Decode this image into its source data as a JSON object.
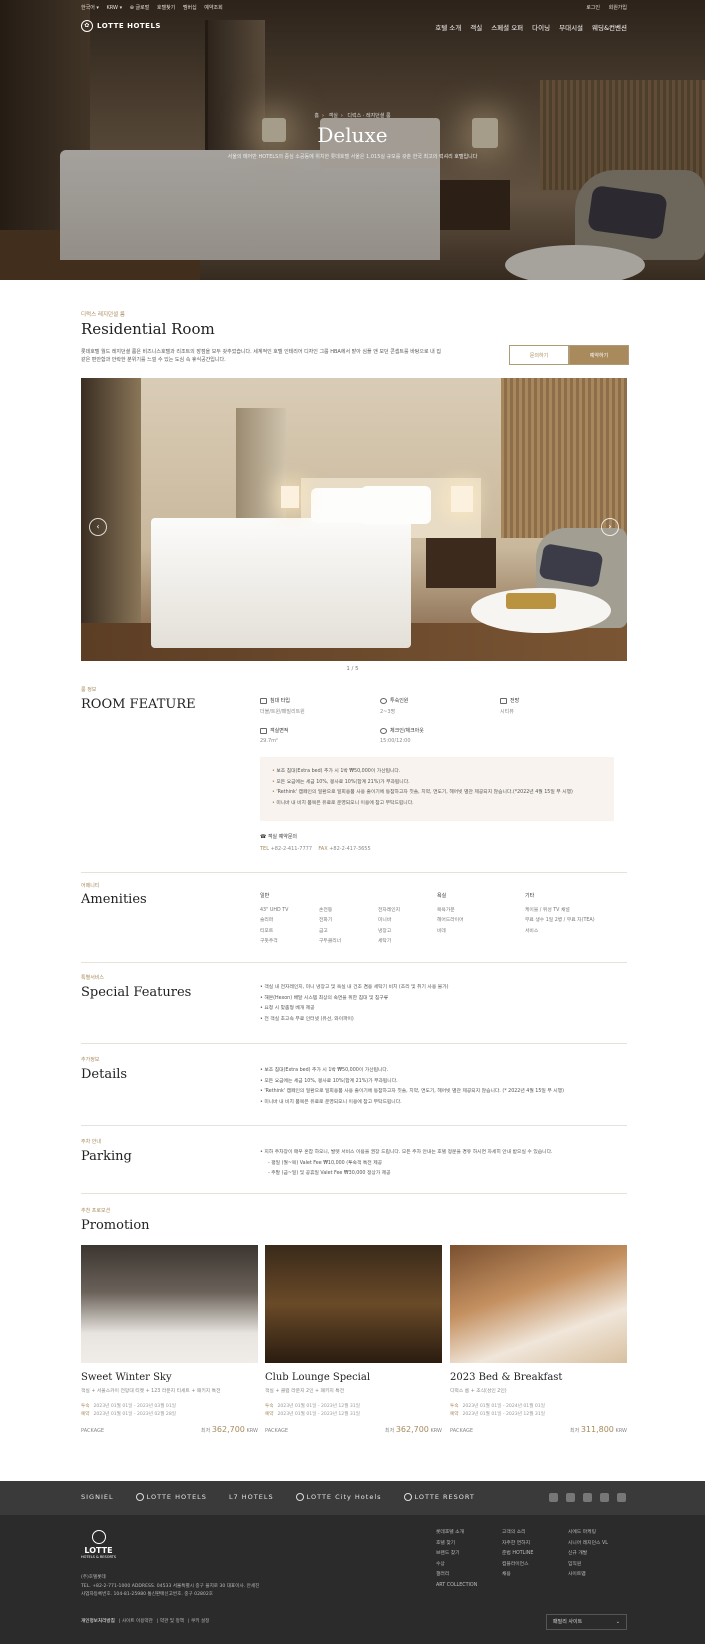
{
  "topbar": {
    "lang": "한국어 ▾",
    "currency": "KRW ▾",
    "links": [
      "⊕ 글로벌",
      "호텔찾기",
      "멤버십",
      "예약조회"
    ],
    "login": "로그인",
    "signup": "회원가입"
  },
  "nav": {
    "logo": "LOTTE HOTELS",
    "items": [
      "호텔 소개",
      "객실",
      "스페셜 오퍼",
      "다이닝",
      "부대시설",
      "웨딩&컨벤션"
    ]
  },
  "hero": {
    "breadcrumb": [
      "홈",
      "객실",
      "디럭스 · 레지던셜 룸"
    ],
    "title": "Deluxe",
    "desc": "서울의 메어반 HOTELS의 중심 소공동에 위치한 롯데호텔 서울은 1,015실 규모를 갖춘 한국 최고의 럭셔리 호텔입니다"
  },
  "room": {
    "category": "디럭스 레지던셜 룸",
    "title": "Residential Room",
    "desc": "롯데호텔 월드 레지던셜 룸은 비즈니스호텔과 리조트의 장점을 모두 갖추었습니다. 세계적인 호텔 인테리어 디자인 그룹 HBA에서 맡아 심플 앤 모던 콘셉트를 바탕으로 내 집 같은 편안함과 안락한 분위기를 느낄 수 있는 도심 속 휴식공간입니다.",
    "inquire_btn": "문의하기",
    "book_btn": "예약하기",
    "pager": "1 / 5"
  },
  "feature": {
    "eyebrow": "룸 정보",
    "title": "ROOM FEATURE",
    "items": [
      {
        "label": "침대 타입",
        "value": "더블/트윈/패밀리트윈"
      },
      {
        "label": "투숙인원",
        "value": "2~3명"
      },
      {
        "label": "전망",
        "value": "시티뷰"
      },
      {
        "label": "객실면적",
        "value": "29.7m²"
      },
      {
        "label": "체크인/체크아웃",
        "value": "15:00/12:00"
      }
    ],
    "notices": [
      "보조 침대(Extra bed) 추가 시 1박 ₩50,000이 가산됩니다.",
      "모든 요금에는 세금 10%, 봉사료 10%(합계 21%)가 부과됩니다.",
      "'Rethink' 캠페인의 일환으로 일회용품 사용 줄이기에 동참하고자 칫솔, 치약, 면도기, 헤어빗 별관 제공되지 않습니다.(*2022년 4월 15일 부 시행)",
      "미니바 내 비치 품목은 유료로 운영되오니 이용에 참고 부탁드립니다."
    ],
    "res_title": "객실 예약문의",
    "tel_label": "TEL",
    "tel": "+82-2-411-7777",
    "fax_label": "FAX",
    "fax": "+82-2-417-3655"
  },
  "amenities": {
    "eyebrow": "어메니티",
    "title": "Amenities",
    "cols": [
      {
        "head": "일반",
        "items": [
          "43\" UHD TV",
          "슬리퍼",
          "티포트",
          "구둣주걱"
        ]
      },
      {
        "head": "",
        "items": [
          "손전등",
          "전화기",
          "금고",
          "구두클리너"
        ]
      },
      {
        "head": "",
        "items": [
          "전자레인지",
          "미니바",
          "냉장고",
          "세탁기"
        ]
      },
      {
        "head": "욕실",
        "items": [
          "목욕가운",
          "헤어드라이어",
          "비데"
        ]
      },
      {
        "head": "기타",
        "items": [
          "케이블 / 위성 TV 채널",
          "무료 생수 1일 2병 / 무료 차(TEA)",
          "서비스"
        ]
      }
    ]
  },
  "special": {
    "eyebrow": "특별서비스",
    "title": "Special Features",
    "items": [
      "객실 내 전자레인지, 미니 냉장고 및 욕실 내 건조 겸용 세탁기 비치 (조리 및 취기 사용 불가)",
      "해몬(Hexon) 배달 시스템 최상의 숙면을 위한 침대 및 침구류",
      "요청 시 맞춤형 베개 제공",
      "전 객실 초고속 무료 인터넷 (유선, 와이파이)"
    ]
  },
  "details": {
    "eyebrow": "추가정보",
    "title": "Details",
    "items": [
      "보조 침대(Extra bed) 추가 시 1박 ₩50,000이 가산됩니다.",
      "모든 요금에는 세금 10%, 봉사료 10%(합계 21%)가 부과됩니다.",
      "'Rethink' 캠페인의 일환으로 일회용품 사용 줄이기에 동참하고자 칫솔, 치약, 면도기, 헤어빗 별관 제공되지 않습니다. (* 2022년 4월 15일 부 시행)",
      "미니바 내 비치 품목은 유료로 운영되오니 이용에 참고 부탁드립니다."
    ]
  },
  "parking": {
    "eyebrow": "주차 안내",
    "title": "Parking",
    "items": [
      "지하 주차장이 매우 혼잡 하오니, 발렛 서비스 이용을 권장 드립니다. 모든 주차 안내는 호텔 정문을 경유 하시면 자세히 안내 받으실 수 있습니다.",
      "평일 (월~목) Valet Fee ₩10,000 (투숙객 특전 제공",
      "주말 (금~일) 및 공휴일 Valet Fee ₩30,000 정상가 제공"
    ]
  },
  "promotion": {
    "eyebrow": "추천 프로모션",
    "title": "Promotion",
    "cards": [
      {
        "title": "Sweet Winter Sky",
        "sub": "객실 + 서울스카이 전망대 티켓 + 123 라운지 티세트 + 패키지 특전",
        "stay_label": "투숙",
        "stay": "2023년 01월 01일 - 2023년 03월 01일",
        "book_label": "예약",
        "book": "2023년 01월 01일 - 2023년 02월 28일",
        "type": "PACKAGE",
        "from": "최저",
        "price": "362,700",
        "cur": "KRW"
      },
      {
        "title": "Club Lounge Special",
        "sub": "객실 + 클럽 라운지 2인 + 패키지 특전",
        "stay_label": "투숙",
        "stay": "2023년 01월 01일 - 2023년 12월 31일",
        "book_label": "예약",
        "book": "2023년 01월 01일 - 2023년 12월 31일",
        "type": "PACKAGE",
        "from": "최저",
        "price": "362,700",
        "cur": "KRW"
      },
      {
        "title": "2023 Bed & Breakfast",
        "sub": "디럭스 룸 + 조식(성인 2인)",
        "stay_label": "투숙",
        "stay": "2023년 01월 01일 - 2024년 01월 01일",
        "book_label": "예약",
        "book": "2023년 01월 01일 - 2023년 12월 31일",
        "type": "PACKAGE",
        "from": "최저",
        "price": "311,800",
        "cur": "KRW"
      }
    ]
  },
  "footer": {
    "brands": [
      "SIGNIEL",
      "LOTTE HOTELS",
      "L7 HOTELS",
      "LOTTE City Hotels",
      "LOTTE RESORT"
    ],
    "logo": "LOTTE",
    "logo_sub": "HOTELS & RESORTS",
    "company": "(주)호텔롯데",
    "address": "TEL. +82-2-771-1000    ADDRESS. 04533 서울특별시 중구 을지로 30    대표이사. 안세진",
    "bizno": "사업자등록번호. 104-81-25980    통신판매신고번호. 중구 02802호",
    "links": [
      "개인정보처리방침",
      "사이트 이용약관",
      "약관 및 정책",
      "쿠키 설정"
    ],
    "col1": [
      "롯데호텔 소개",
      "호텔 찾기",
      "브랜드 찾기",
      "수상",
      "갤러리",
      "ART COLLECTION"
    ],
    "col2": [
      "고객의 소리",
      "자주한 면하지",
      "준법 HOTLINE",
      "컴플라이언스",
      "채용"
    ],
    "col3": [
      "시에드 마케팅",
      "시니어 레지던스 VL",
      "신규 개발",
      "임직원",
      "사이트맵"
    ],
    "family": "패밀리 사이트"
  }
}
